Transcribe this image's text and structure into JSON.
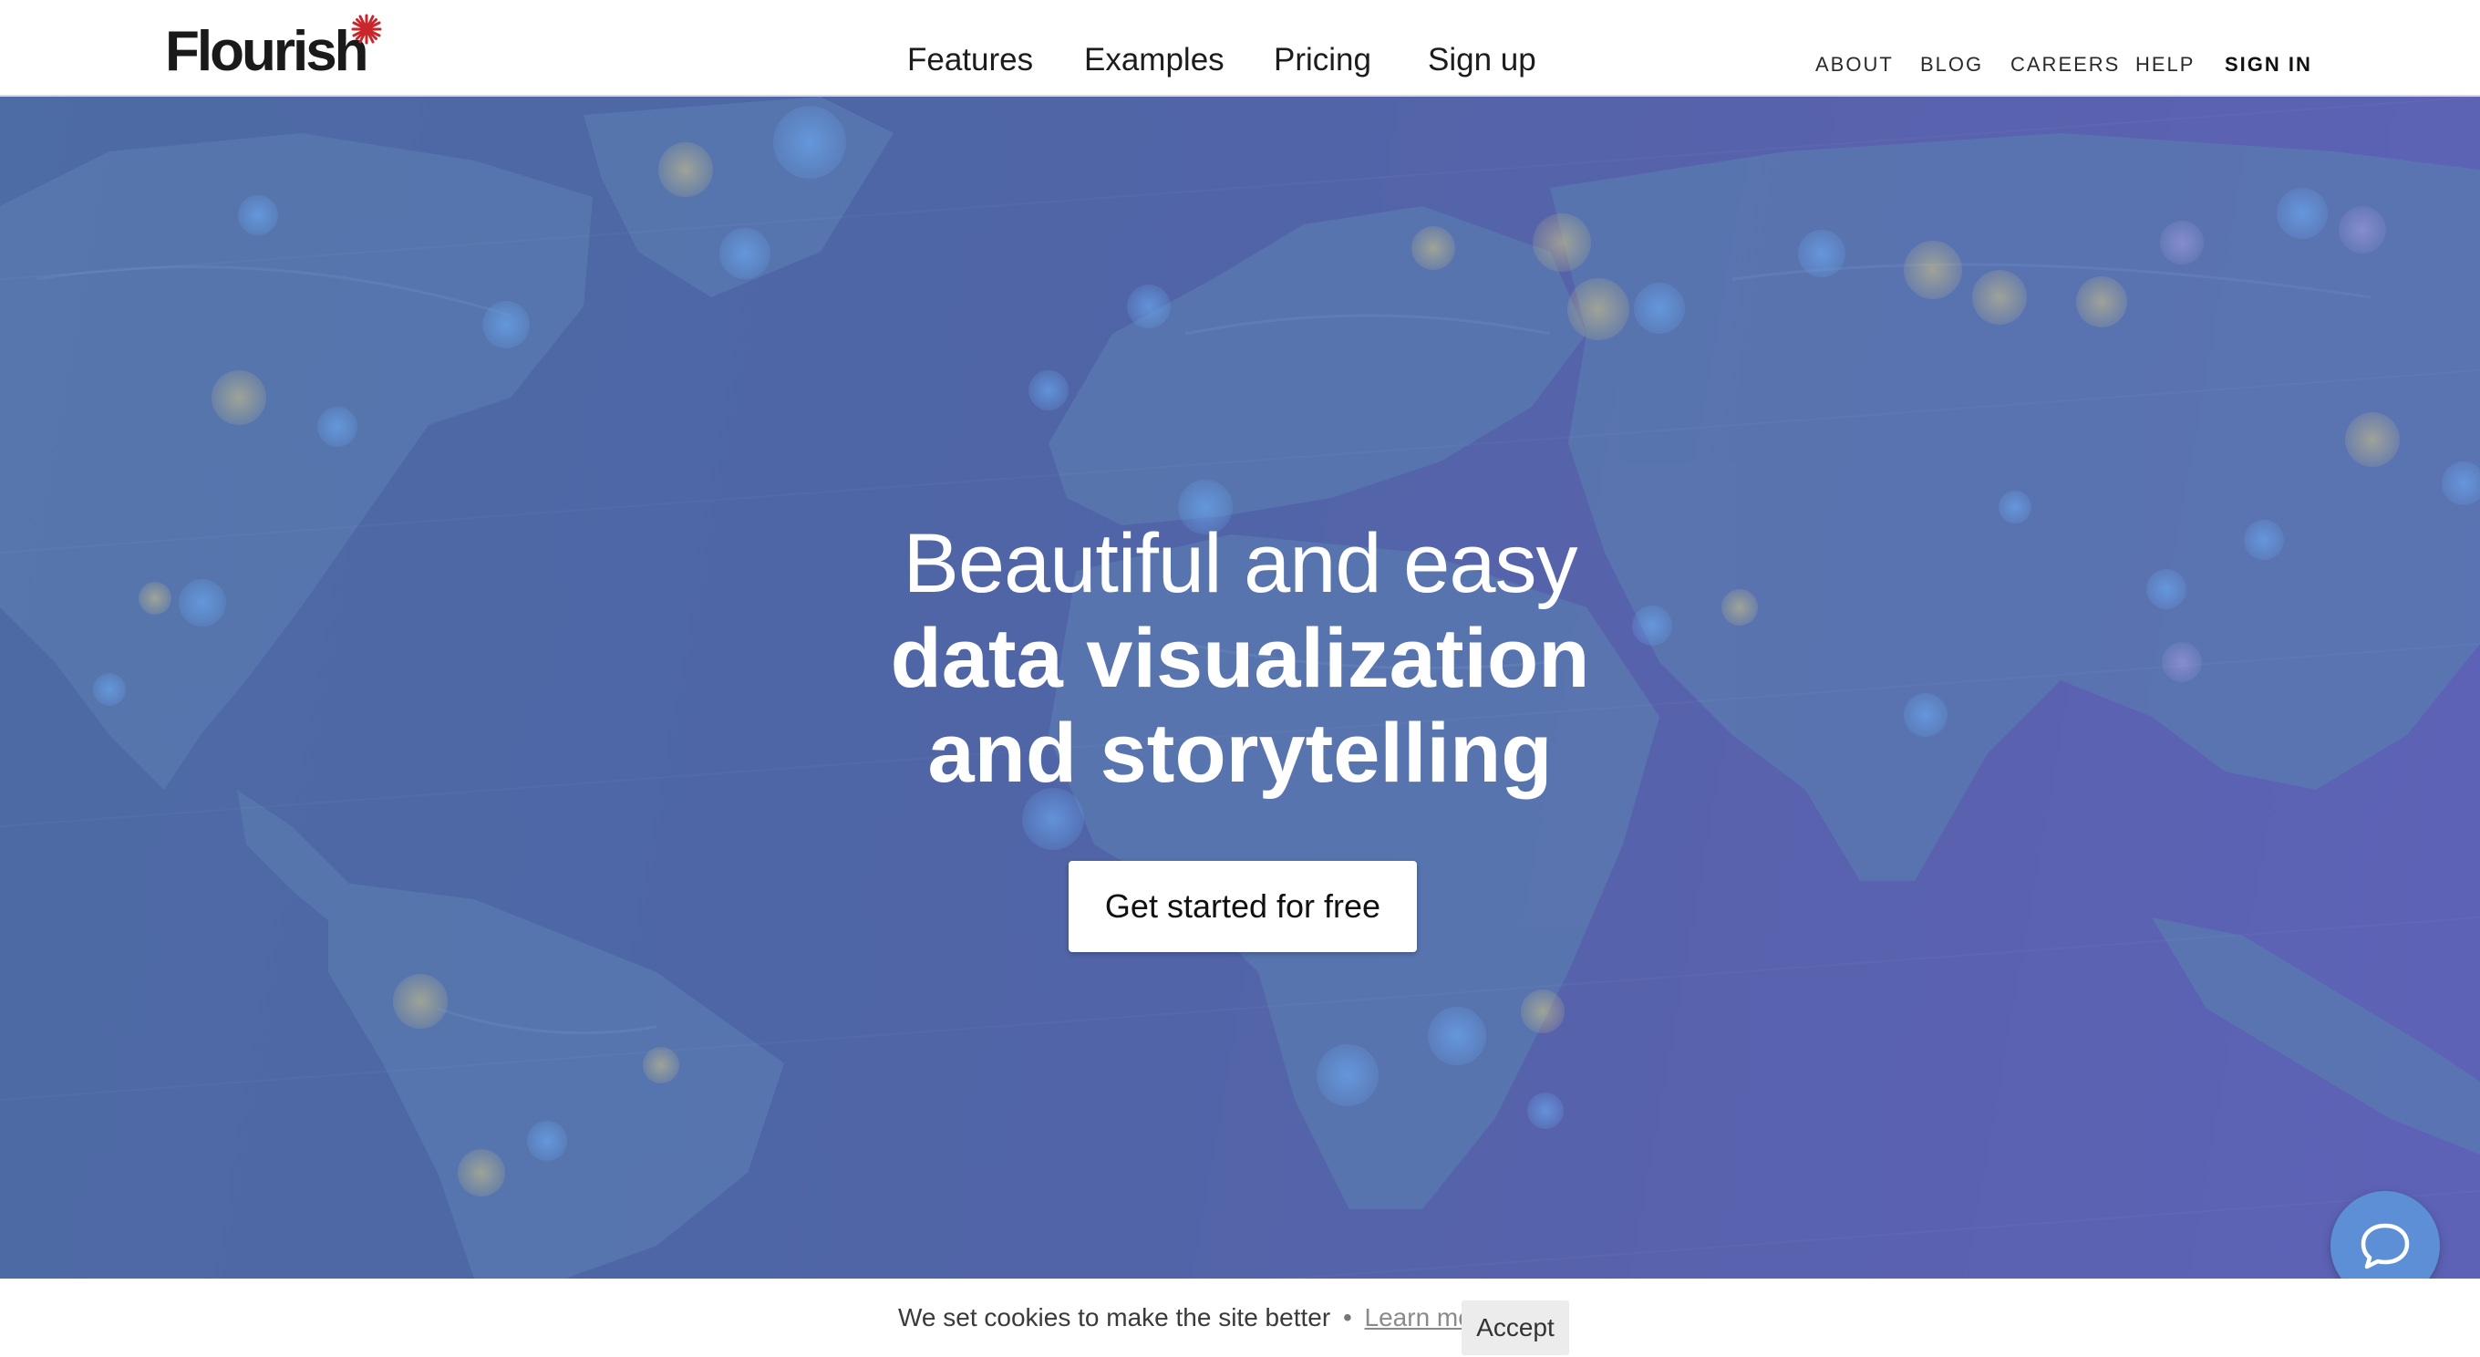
{
  "header": {
    "logo_text": "Flourish",
    "main_nav": [
      "Features",
      "Examples",
      "Pricing",
      "Sign up"
    ],
    "util_nav": [
      "ABOUT",
      "BLOG",
      "CAREERS",
      "HELP",
      "SIGN IN"
    ]
  },
  "hero": {
    "line1": "Beautiful and easy",
    "line2": "data visualization",
    "line3": "and storytelling",
    "cta_label": "Get started for free",
    "background_color": "#4f65a6"
  },
  "chat": {
    "icon": "chat-bubble-icon",
    "color": "#5c8fd6"
  },
  "cookie_bar": {
    "text": "We set cookies to make the site better",
    "separator": "•",
    "learn_more_label": "Learn more",
    "accept_label": "Accept"
  },
  "colors": {
    "logo_mark": "#c8262b",
    "text_dark": "#1c1c1c"
  }
}
